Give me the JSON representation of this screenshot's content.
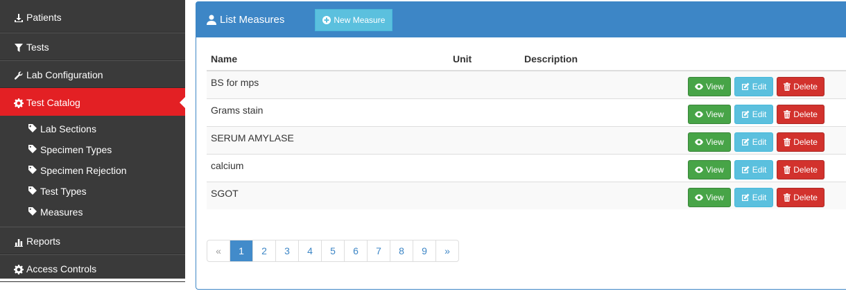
{
  "sidebar": {
    "items": [
      {
        "label": "Patients"
      },
      {
        "label": "Tests"
      },
      {
        "label": "Lab Configuration"
      },
      {
        "label": "Test Catalog"
      },
      {
        "label": "Reports"
      },
      {
        "label": "Access Controls"
      }
    ],
    "sub_items": [
      {
        "label": "Lab Sections"
      },
      {
        "label": "Specimen Types"
      },
      {
        "label": "Specimen Rejection"
      },
      {
        "label": "Test Types"
      },
      {
        "label": "Measures"
      }
    ]
  },
  "panel": {
    "title": "List Measures",
    "new_button": "New Measure"
  },
  "table": {
    "headers": {
      "name": "Name",
      "unit": "Unit",
      "description": "Description"
    },
    "rows": [
      {
        "name": "BS for mps",
        "unit": "",
        "description": ""
      },
      {
        "name": "Grams stain",
        "unit": "",
        "description": ""
      },
      {
        "name": "SERUM AMYLASE",
        "unit": "",
        "description": ""
      },
      {
        "name": "calcium",
        "unit": "",
        "description": ""
      },
      {
        "name": "SGOT",
        "unit": "",
        "description": ""
      }
    ],
    "actions": {
      "view": "View",
      "edit": "Edit",
      "delete": "Delete"
    }
  },
  "pagination": {
    "prev": "«",
    "next": "»",
    "pages": [
      "1",
      "2",
      "3",
      "4",
      "5",
      "6",
      "7",
      "8",
      "9"
    ],
    "current": "1"
  },
  "colors": {
    "sidebar_bg": "#3a3a3a",
    "active_red": "#e32024",
    "panel_blue": "#3d86c6",
    "view_green": "#47a447",
    "edit_cyan": "#5bc0de",
    "delete_red": "#d2322d"
  }
}
